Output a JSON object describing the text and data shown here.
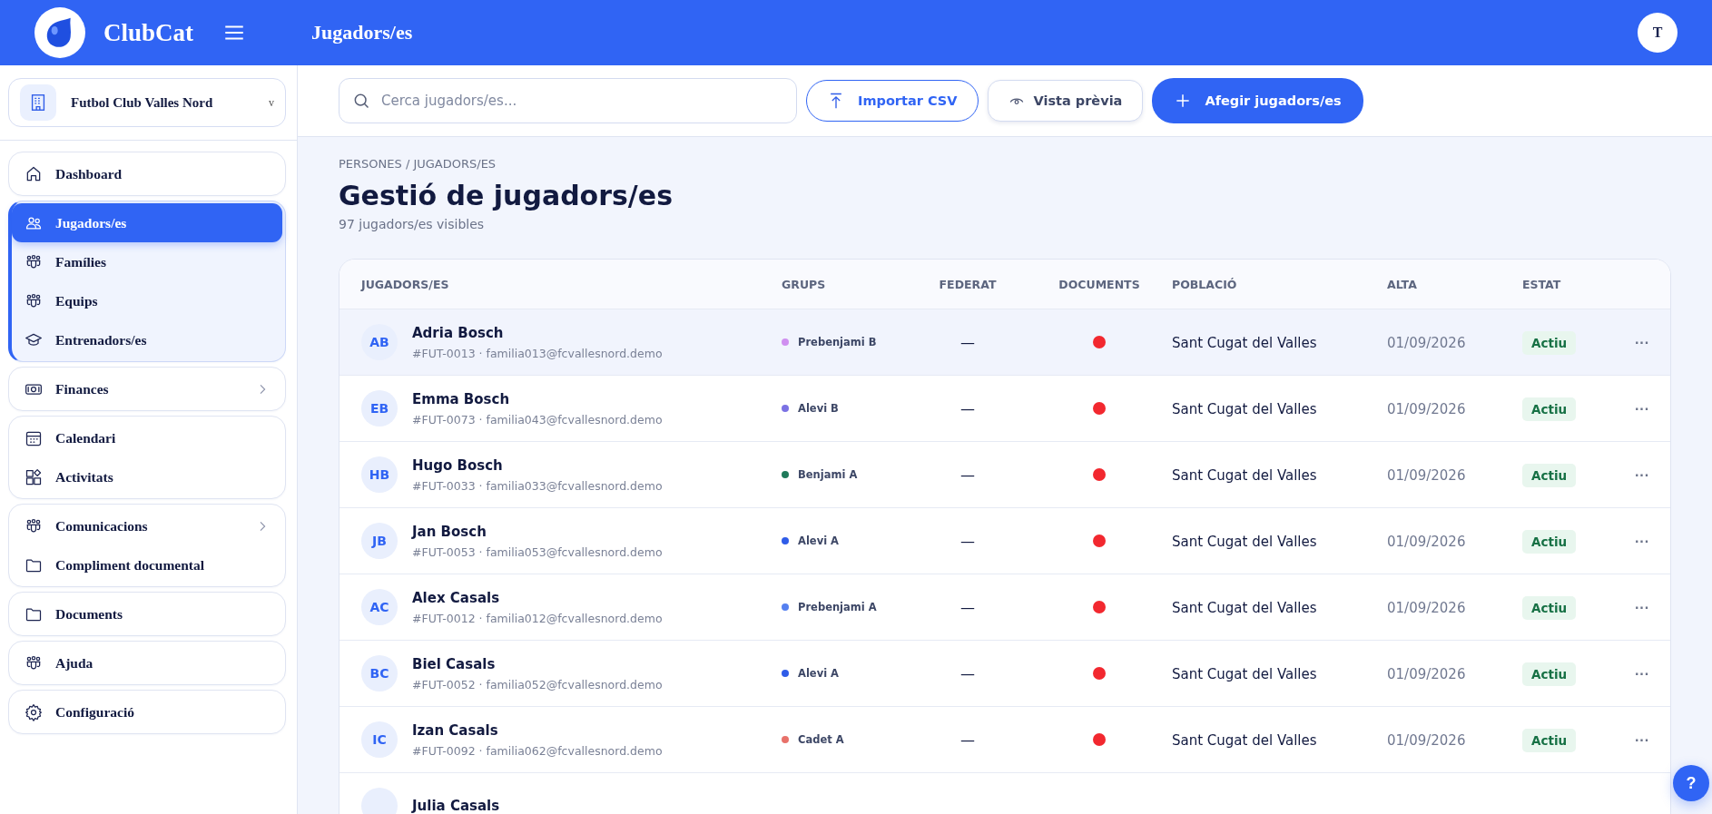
{
  "app": {
    "name": "ClubCat",
    "page_title": "Jugadors/es",
    "user_initial": "T"
  },
  "club_selector": {
    "name": "Futbol Club Valles Nord",
    "caret": "v"
  },
  "sidebar": {
    "groups": [
      {
        "items": [
          {
            "label": "Dashboard",
            "selected": false,
            "chevron": false
          }
        ]
      },
      {
        "expanded": true,
        "items": [
          {
            "label": "Jugadors/es",
            "selected": true,
            "chevron": false
          },
          {
            "label": "Famílies",
            "selected": false,
            "chevron": false
          },
          {
            "label": "Equips",
            "selected": false,
            "chevron": false
          },
          {
            "label": "Entrenadors/es",
            "selected": false,
            "chevron": false
          }
        ]
      },
      {
        "items": [
          {
            "label": "Finances",
            "selected": false,
            "chevron": true
          }
        ]
      },
      {
        "items": [
          {
            "label": "Calendari",
            "selected": false,
            "chevron": false
          },
          {
            "label": "Activitats",
            "selected": false,
            "chevron": false
          }
        ]
      },
      {
        "items": [
          {
            "label": "Comunicacions",
            "selected": false,
            "chevron": true
          },
          {
            "label": "Compliment documental",
            "selected": false,
            "chevron": false
          }
        ]
      },
      {
        "items": [
          {
            "label": "Documents",
            "selected": false,
            "chevron": false
          }
        ]
      },
      {
        "items": [
          {
            "label": "Ajuda",
            "selected": false,
            "chevron": false
          }
        ]
      },
      {
        "items": [
          {
            "label": "Configuració",
            "selected": false,
            "chevron": false
          }
        ]
      }
    ]
  },
  "toolbar": {
    "search": {
      "placeholder": "Cerca jugadors/es..."
    },
    "buttons": [
      {
        "kind": "outline",
        "label": "Importar CSV"
      },
      {
        "kind": "ghost",
        "label": "Vista prèvia"
      },
      {
        "kind": "primary",
        "label": "Afegir jugadors/es"
      }
    ]
  },
  "breadcrumb": "PERSONES / JUGADORS/ES",
  "heading": "Gestió de jugadors/es",
  "subheading": "97 jugadors/es visibles",
  "table": {
    "columns": [
      "JUGADORS/ES",
      "GRUPS",
      "FEDERAT",
      "DOCUMENTS",
      "POBLACIÓ",
      "ALTA",
      "ESTAT"
    ],
    "rows": [
      {
        "initials": "AB",
        "name": "Adria Bosch",
        "meta": "#FUT-0013 · familia013@fcvallesnord.demo",
        "group": "Prebenjami B",
        "color": "#cf8ff0",
        "federat": "—",
        "documents_ok": false,
        "town": "Sant Cugat del Valles",
        "date": "01/09/2026",
        "status": "Actiu",
        "actions": "···",
        "hovered": true
      },
      {
        "initials": "EB",
        "name": "Emma Bosch",
        "meta": "#FUT-0073 · familia043@fcvallesnord.demo",
        "group": "Alevi B",
        "color": "#7b72e4",
        "federat": "—",
        "documents_ok": false,
        "town": "Sant Cugat del Valles",
        "date": "01/09/2026",
        "status": "Actiu",
        "actions": "···",
        "hovered": false
      },
      {
        "initials": "HB",
        "name": "Hugo Bosch",
        "meta": "#FUT-0033 · familia033@fcvallesnord.demo",
        "group": "Benjami A",
        "color": "#1f7a5a",
        "federat": "—",
        "documents_ok": false,
        "town": "Sant Cugat del Valles",
        "date": "01/09/2026",
        "status": "Actiu",
        "actions": "···",
        "hovered": false
      },
      {
        "initials": "JB",
        "name": "Jan Bosch",
        "meta": "#FUT-0053 · familia053@fcvallesnord.demo",
        "group": "Alevi A",
        "color": "#2f5ce8",
        "federat": "—",
        "documents_ok": false,
        "town": "Sant Cugat del Valles",
        "date": "01/09/2026",
        "status": "Actiu",
        "actions": "···",
        "hovered": false
      },
      {
        "initials": "AC",
        "name": "Alex Casals",
        "meta": "#FUT-0012 · familia012@fcvallesnord.demo",
        "group": "Prebenjami A",
        "color": "#5580f0",
        "federat": "—",
        "documents_ok": false,
        "town": "Sant Cugat del Valles",
        "date": "01/09/2026",
        "status": "Actiu",
        "actions": "···",
        "hovered": false
      },
      {
        "initials": "BC",
        "name": "Biel Casals",
        "meta": "#FUT-0052 · familia052@fcvallesnord.demo",
        "group": "Alevi A",
        "color": "#2f5ce8",
        "federat": "—",
        "documents_ok": false,
        "town": "Sant Cugat del Valles",
        "date": "01/09/2026",
        "status": "Actiu",
        "actions": "···",
        "hovered": false
      },
      {
        "initials": "IC",
        "name": "Izan Casals",
        "meta": "#FUT-0092 · familia062@fcvallesnord.demo",
        "group": "Cadet A",
        "color": "#e8716a",
        "federat": "—",
        "documents_ok": false,
        "town": "Sant Cugat del Valles",
        "date": "01/09/2026",
        "status": "Actiu",
        "actions": "···",
        "hovered": false
      },
      {
        "name": "Julia Casals",
        "hovered": false
      }
    ]
  },
  "help_button": "?"
}
